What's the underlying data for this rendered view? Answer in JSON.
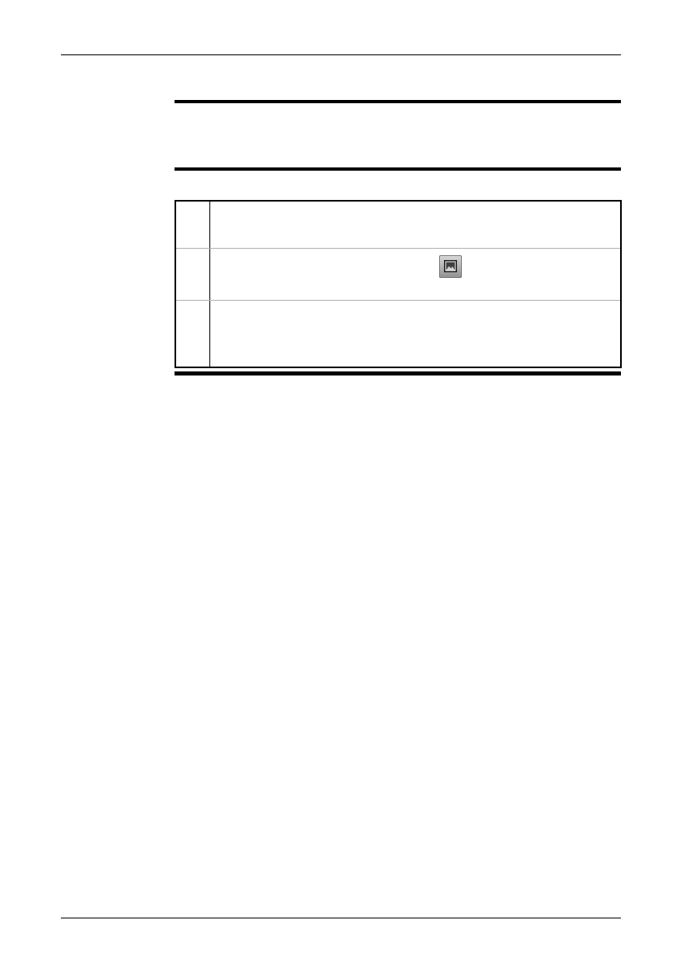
{
  "header": {
    "page_number": "",
    "section_label": ""
  },
  "section": {
    "title": "",
    "note": ""
  },
  "steps": [
    {
      "number": "",
      "text": ""
    },
    {
      "number": "",
      "text": ""
    },
    {
      "number": "",
      "text": ""
    }
  ],
  "icons": {
    "gallery_button": "image-gallery-icon"
  },
  "footer": {
    "text": ""
  },
  "colors": {
    "rule": "#000000",
    "row_divider": "#b0b0b0",
    "button_gradient_top": "#d9d9d9",
    "button_gradient_bottom": "#8f8f8f"
  }
}
